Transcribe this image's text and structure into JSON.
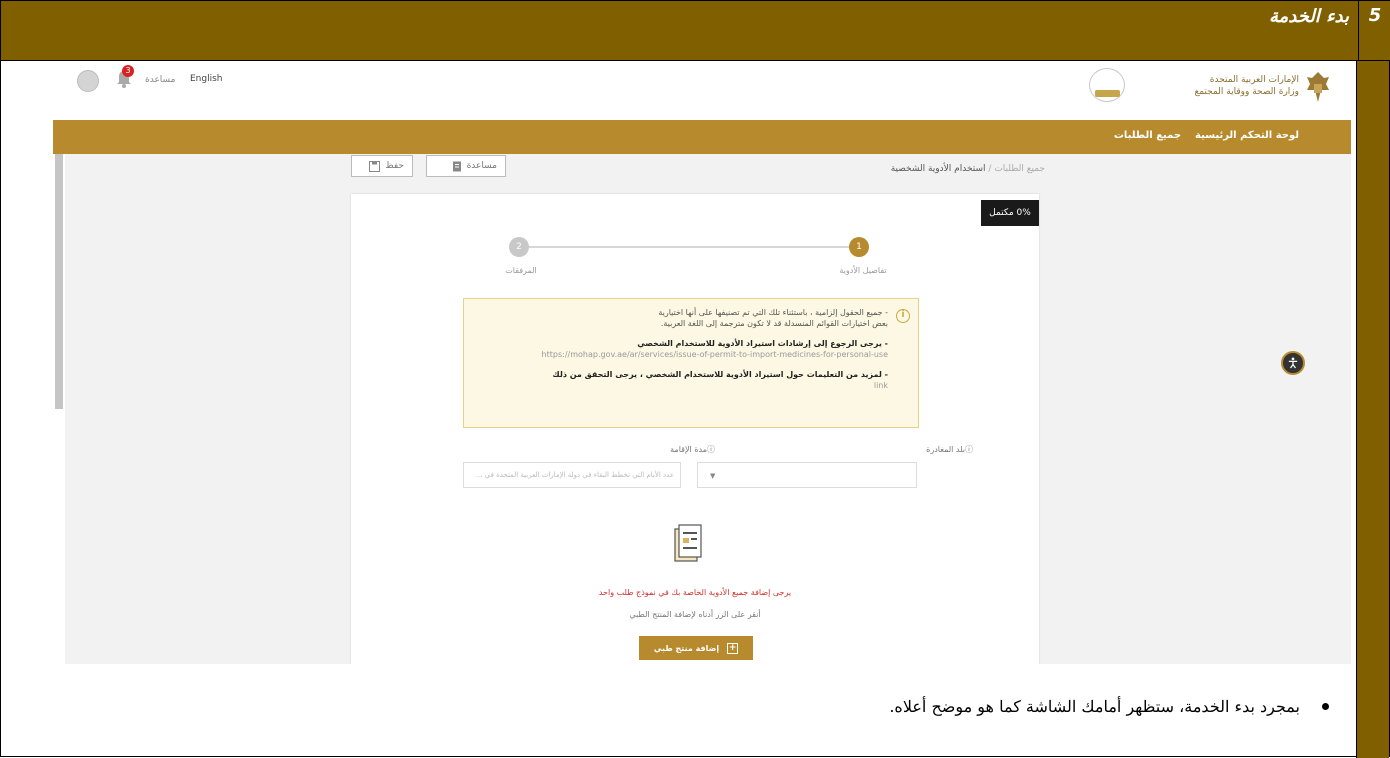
{
  "doc": {
    "section_number": "5",
    "section_title": "بدء الخدمة",
    "caption": "بمجرد بدء الخدمة، ستظهر أمامك الشاشة كما هو موضح أعلاه."
  },
  "app": {
    "logo_line1": "الإمارات العربية المتحدة",
    "logo_line2": "وزارة الصحة ووقاية المجتمع",
    "language": "English",
    "help": "مساعدة",
    "notification_count": "3",
    "nav": {
      "dashboard": "لوحة التحكم الرئيسية",
      "all_requests": "جميع الطلبات"
    },
    "breadcrumb": {
      "parent": "جميع الطلبات",
      "separator": "/",
      "current": "استخدام الأدوية الشخصية"
    },
    "toolbar": {
      "help_label": "مساعدة",
      "save_label": "حفظ"
    },
    "progress": "0% مكتمل",
    "steps": [
      {
        "number": "1",
        "label": "تفاصيل الأدوية"
      },
      {
        "number": "2",
        "label": "المرفقات"
      }
    ],
    "notice": {
      "line1": "- جميع الحقول إلزامية ، باستثناء تلك التي تم تصنيفها على أنها اختيارية",
      "line2": "بعض اختيارات القوائم المنسدلة قد لا تكون مترجمة إلى اللغة العربية.",
      "line3": "- يرجى الرجوع إلى إرشادات استيراد الأدوية للاستخدام الشخصي",
      "link1": "https://mohap.gov.ae/ar/services/issue-of-permit-to-import-medicines-for-personal-use",
      "line4": "- لمزيد من التعليمات حول استيراد الأدوية للاستخدام الشخصي ، يرجى التحقق من ذلك",
      "link2": "link"
    },
    "fields": {
      "departure_label": "بلد المغادرة",
      "stay_label": "مدة الإقامة",
      "stay_placeholder": "عدد الأيام التي تخطط البقاء في دولة الإمارات العربية المتحدة في ..."
    },
    "empty": {
      "warning": "يرجى إضافة جميع الأدوية الخاصة بك في نموذج طلب واحد",
      "hint": "أنقر على الزر أدناه لإضافة المنتج الطبي",
      "add_button": "إضافة منتج طبي"
    }
  },
  "colors": {
    "doc_header": "#7f5f00",
    "app_gold": "#b88a2e",
    "warning_red": "#d03030"
  }
}
